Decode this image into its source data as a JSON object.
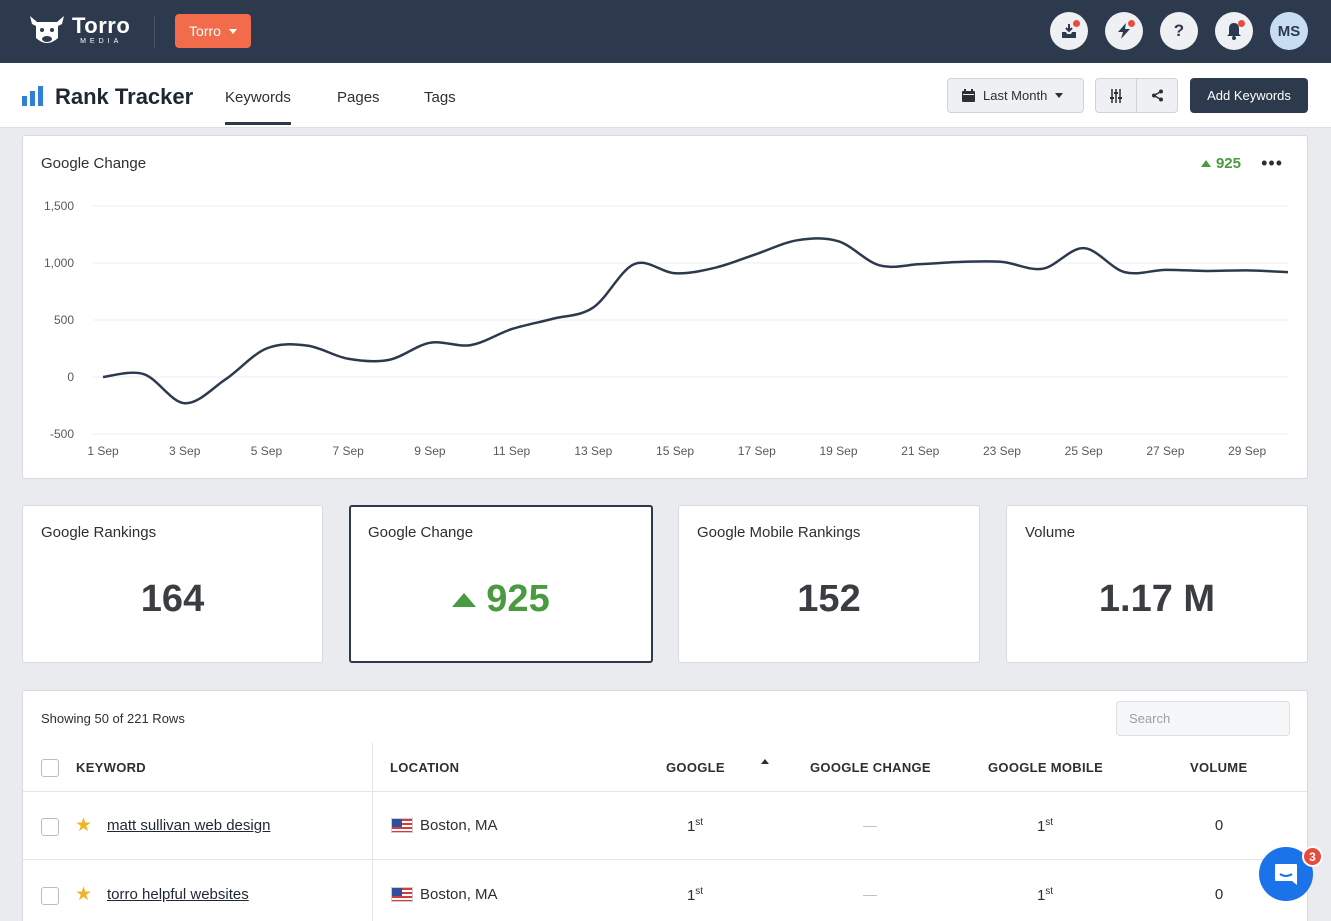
{
  "brand": {
    "name": "Torro",
    "sub": "MEDIA"
  },
  "workspace": {
    "label": "Torro"
  },
  "user": {
    "initials": "MS"
  },
  "topbar_icons": [
    "inbox-download-icon",
    "lightning-icon",
    "help-icon",
    "bell-icon"
  ],
  "page": {
    "title": "Rank Tracker",
    "tabs": [
      {
        "label": "Keywords",
        "active": true
      },
      {
        "label": "Pages",
        "active": false
      },
      {
        "label": "Tags",
        "active": false
      }
    ],
    "date_range": "Last Month",
    "add_button": "Add Keywords"
  },
  "chart_card": {
    "title": "Google Change",
    "change_value": "925"
  },
  "chart_data": {
    "type": "line",
    "title": "Google Change",
    "x": [
      "1 Sep",
      "2 Sep",
      "3 Sep",
      "4 Sep",
      "5 Sep",
      "6 Sep",
      "7 Sep",
      "8 Sep",
      "9 Sep",
      "10 Sep",
      "11 Sep",
      "12 Sep",
      "13 Sep",
      "14 Sep",
      "15 Sep",
      "16 Sep",
      "17 Sep",
      "18 Sep",
      "19 Sep",
      "20 Sep",
      "21 Sep",
      "22 Sep",
      "23 Sep",
      "24 Sep",
      "25 Sep",
      "26 Sep",
      "27 Sep",
      "28 Sep",
      "29 Sep",
      "30 Sep"
    ],
    "x_tick_labels": [
      "1 Sep",
      "3 Sep",
      "5 Sep",
      "7 Sep",
      "9 Sep",
      "11 Sep",
      "13 Sep",
      "15 Sep",
      "17 Sep",
      "19 Sep",
      "21 Sep",
      "23 Sep",
      "25 Sep",
      "27 Sep",
      "29 Sep"
    ],
    "series": [
      {
        "values": [
          0,
          25,
          -230,
          -20,
          250,
          275,
          160,
          150,
          300,
          280,
          420,
          510,
          610,
          990,
          910,
          960,
          1080,
          1200,
          1190,
          980,
          990,
          1010,
          1010,
          950,
          1130,
          920,
          940,
          930,
          935,
          920
        ]
      }
    ],
    "ylim": [
      -500,
      1500
    ],
    "y_ticks": [
      -500,
      0,
      500,
      1000,
      1500
    ],
    "y_tick_labels": [
      "-500",
      "0",
      "500",
      "1,000",
      "1,500"
    ],
    "grid": true,
    "line_color": "#2d3a4d"
  },
  "stats": [
    {
      "label": "Google Rankings",
      "value": "164"
    },
    {
      "label": "Google Change",
      "value": "925"
    },
    {
      "label": "Google Mobile Rankings",
      "value": "152"
    },
    {
      "label": "Volume",
      "value": "1.17 M"
    }
  ],
  "table": {
    "rows_info": "Showing 50 of 221 Rows",
    "search_placeholder": "Search",
    "columns": [
      "KEYWORD",
      "LOCATION",
      "GOOGLE",
      "GOOGLE CHANGE",
      "GOOGLE MOBILE",
      "VOLUME"
    ],
    "rows": [
      {
        "keyword": "matt sullivan web design",
        "location": "Boston, MA",
        "google": "1",
        "google_sup": "st",
        "change": "—",
        "mobile": "1",
        "mobile_sup": "st",
        "volume": "0"
      },
      {
        "keyword": "torro helpful websites",
        "location": "Boston, MA",
        "google": "1",
        "google_sup": "st",
        "change": "—",
        "mobile": "1",
        "mobile_sup": "st",
        "volume": "0"
      }
    ]
  },
  "chat": {
    "badge": "3"
  },
  "colors": {
    "navbar": "#2d3a4d",
    "accent": "#f26b4b",
    "positive": "#4a9a3f"
  }
}
